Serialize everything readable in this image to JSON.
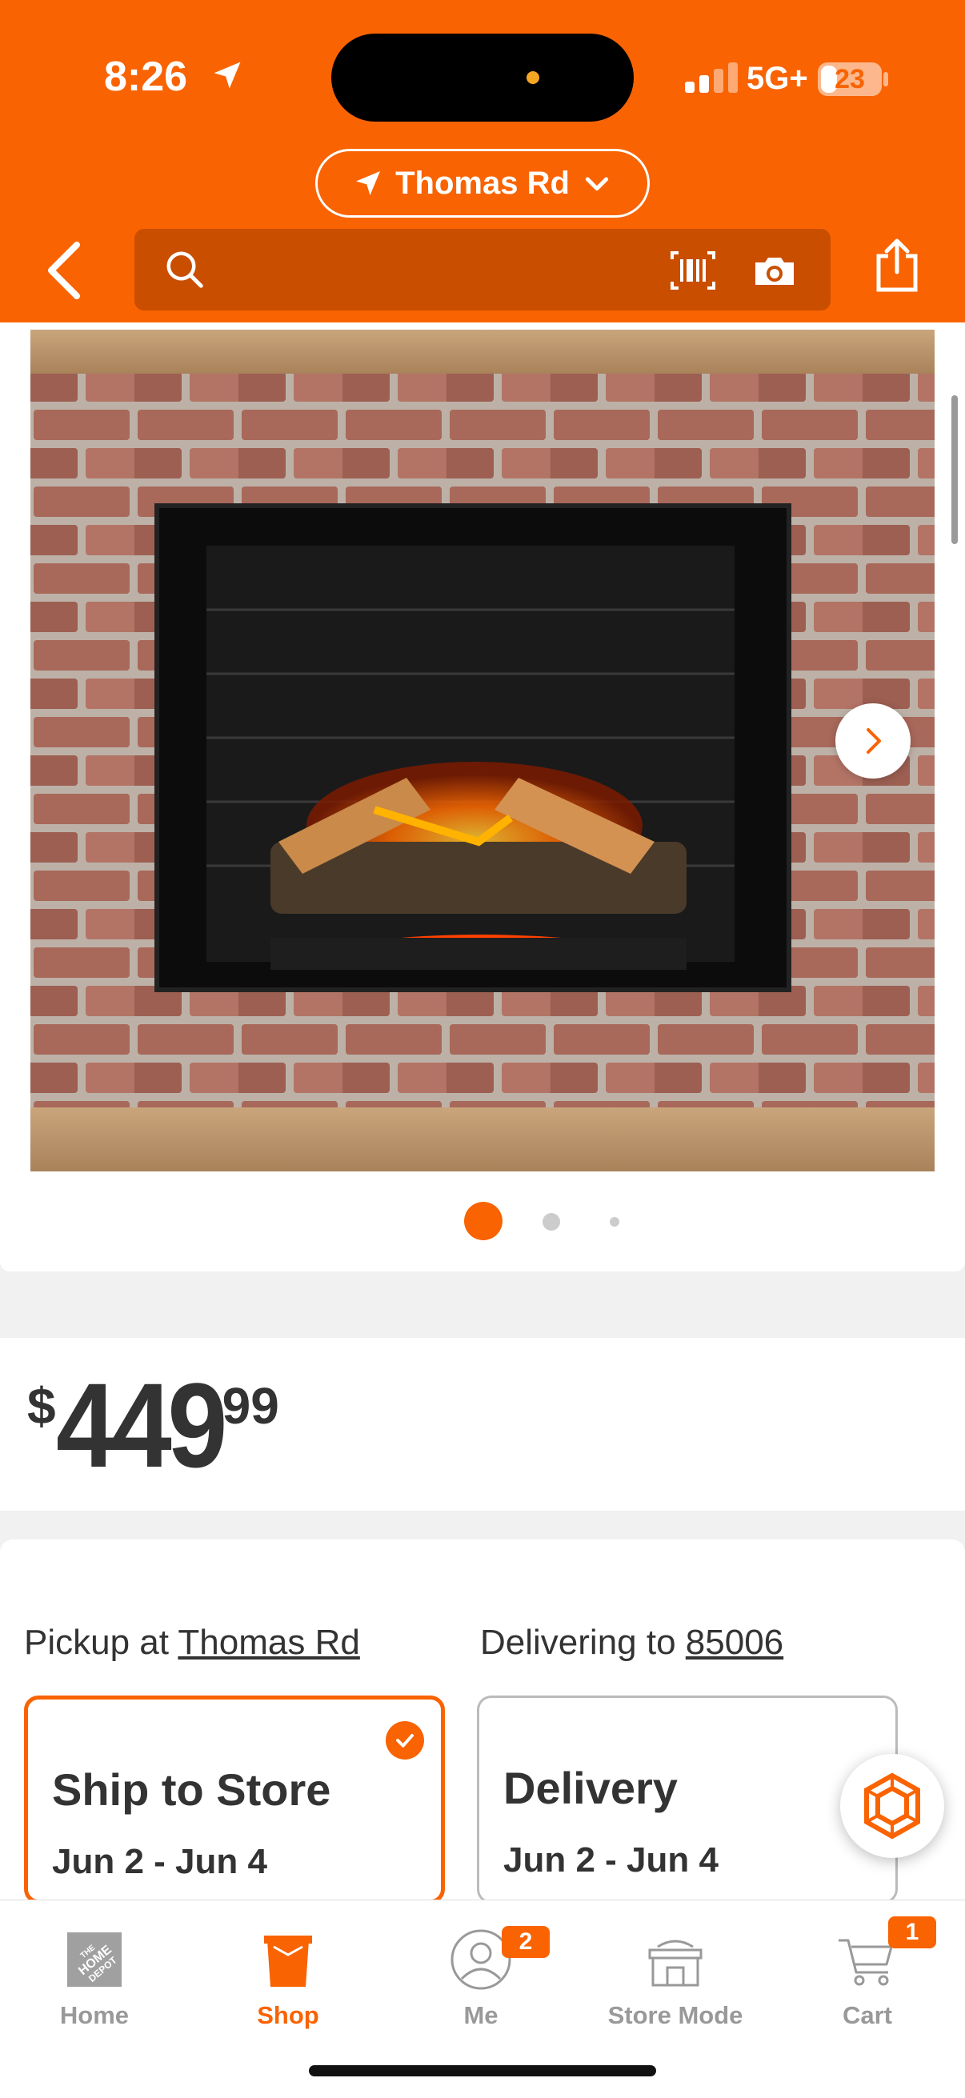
{
  "status_bar": {
    "time": "8:26",
    "network": "5G+",
    "battery": "23"
  },
  "header": {
    "store_name": "Thomas Rd",
    "search_placeholder": "",
    "accent": "#f96302"
  },
  "icons": {
    "back": "chevron-left-icon",
    "search": "search-icon",
    "barcode": "barcode-icon",
    "camera": "camera-icon",
    "share": "share-icon",
    "next": "chevron-right-icon",
    "check": "checkmark-icon"
  },
  "gallery": {
    "image_count": 3,
    "active_index": 0
  },
  "price": {
    "dollar_sign": "$",
    "whole": "449",
    "cents": "99"
  },
  "fulfillment": {
    "pickup_prefix": "Pickup at",
    "pickup_store": "Thomas Rd",
    "delivery_prefix": "Delivering to",
    "delivery_zip": "85006",
    "options": [
      {
        "title": "Ship to Store",
        "date": "Jun 2 - Jun 4",
        "selected": true
      },
      {
        "title": "Delivery",
        "date": "Jun 2 - Jun 4",
        "selected": false
      }
    ]
  },
  "tabbar": {
    "tabs": [
      {
        "label": "Home",
        "icon": "home-depot-logo-icon",
        "active": false
      },
      {
        "label": "Shop",
        "icon": "bucket-icon",
        "active": true
      },
      {
        "label": "Me",
        "icon": "person-icon",
        "active": false,
        "badge": "2"
      },
      {
        "label": "Store Mode",
        "icon": "store-icon",
        "active": false
      },
      {
        "label": "Cart",
        "icon": "cart-icon",
        "active": false,
        "badge": "1"
      }
    ]
  }
}
